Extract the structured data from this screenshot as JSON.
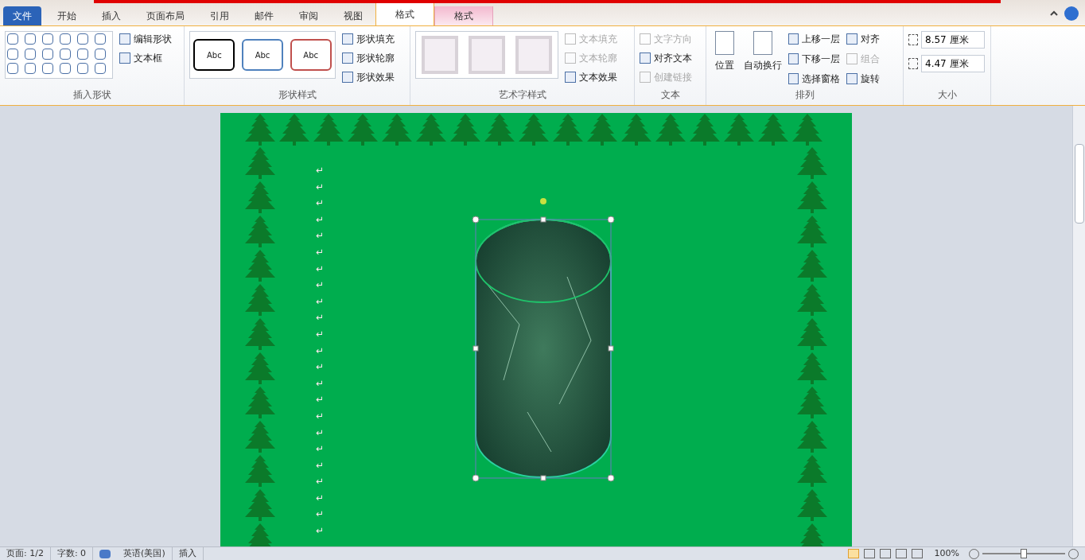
{
  "tabs": [
    {
      "label": "文件",
      "kind": "file",
      "selected": false
    },
    {
      "label": "开始",
      "kind": "normal",
      "selected": false
    },
    {
      "label": "插入",
      "kind": "normal",
      "selected": false
    },
    {
      "label": "页面布局",
      "kind": "normal",
      "selected": false
    },
    {
      "label": "引用",
      "kind": "normal",
      "selected": false
    },
    {
      "label": "邮件",
      "kind": "normal",
      "selected": false
    },
    {
      "label": "审阅",
      "kind": "normal",
      "selected": false
    },
    {
      "label": "视图",
      "kind": "normal",
      "selected": false
    },
    {
      "label": "格式",
      "kind": "normal",
      "selected": true
    },
    {
      "label": "格式",
      "kind": "context",
      "selected": false
    }
  ],
  "groups": {
    "insert_shapes": {
      "title": "插入形状",
      "edit_shape": "编辑形状",
      "text_box": "文本框"
    },
    "shape_styles": {
      "title": "形状样式",
      "styles": [
        {
          "label": "Abc",
          "color": "#000000"
        },
        {
          "label": "Abc",
          "color": "#4f81bd"
        },
        {
          "label": "Abc",
          "color": "#c0504d"
        }
      ],
      "fill": "形状填充",
      "outline": "形状轮廓",
      "effects": "形状效果"
    },
    "wordart": {
      "title": "艺术字样式",
      "items": [
        {
          "label": "文本填充",
          "disabled": true
        },
        {
          "label": "文本轮廓",
          "disabled": true
        },
        {
          "label": "文本效果",
          "disabled": false
        }
      ]
    },
    "text": {
      "title": "文本",
      "items": [
        {
          "label": "文字方向",
          "disabled": true
        },
        {
          "label": "对齐文本",
          "disabled": false
        },
        {
          "label": "创建链接",
          "disabled": true
        }
      ]
    },
    "arrange": {
      "title": "排列",
      "position": "位置",
      "wrap": "自动换行",
      "items": [
        {
          "label": "上移一层",
          "disabled": false
        },
        {
          "label": "下移一层",
          "disabled": false
        },
        {
          "label": "选择窗格",
          "disabled": false
        },
        {
          "label": "对齐",
          "disabled": false
        },
        {
          "label": "组合",
          "disabled": true
        },
        {
          "label": "旋转",
          "disabled": false
        }
      ]
    },
    "size": {
      "title": "大小",
      "height": "8.57 厘米",
      "width": "4.47 厘米"
    }
  },
  "document": {
    "paragraph_marks": [
      "↵",
      "↵",
      "↵",
      "↵",
      "↵",
      "↵",
      "↵",
      "↵",
      "↵",
      "↵",
      "↵",
      "↵",
      "↵",
      "↵",
      "↵",
      "↵",
      "↵",
      "↵",
      "↵",
      "↵",
      "↵",
      "↵",
      "↵"
    ]
  },
  "status_bar": {
    "page": "页面: 1/2",
    "words": "字数: 0",
    "language": "英语(美国)",
    "mode": "插入",
    "zoom": "100%",
    "zoom_level": {
      "level": 0.5
    }
  }
}
